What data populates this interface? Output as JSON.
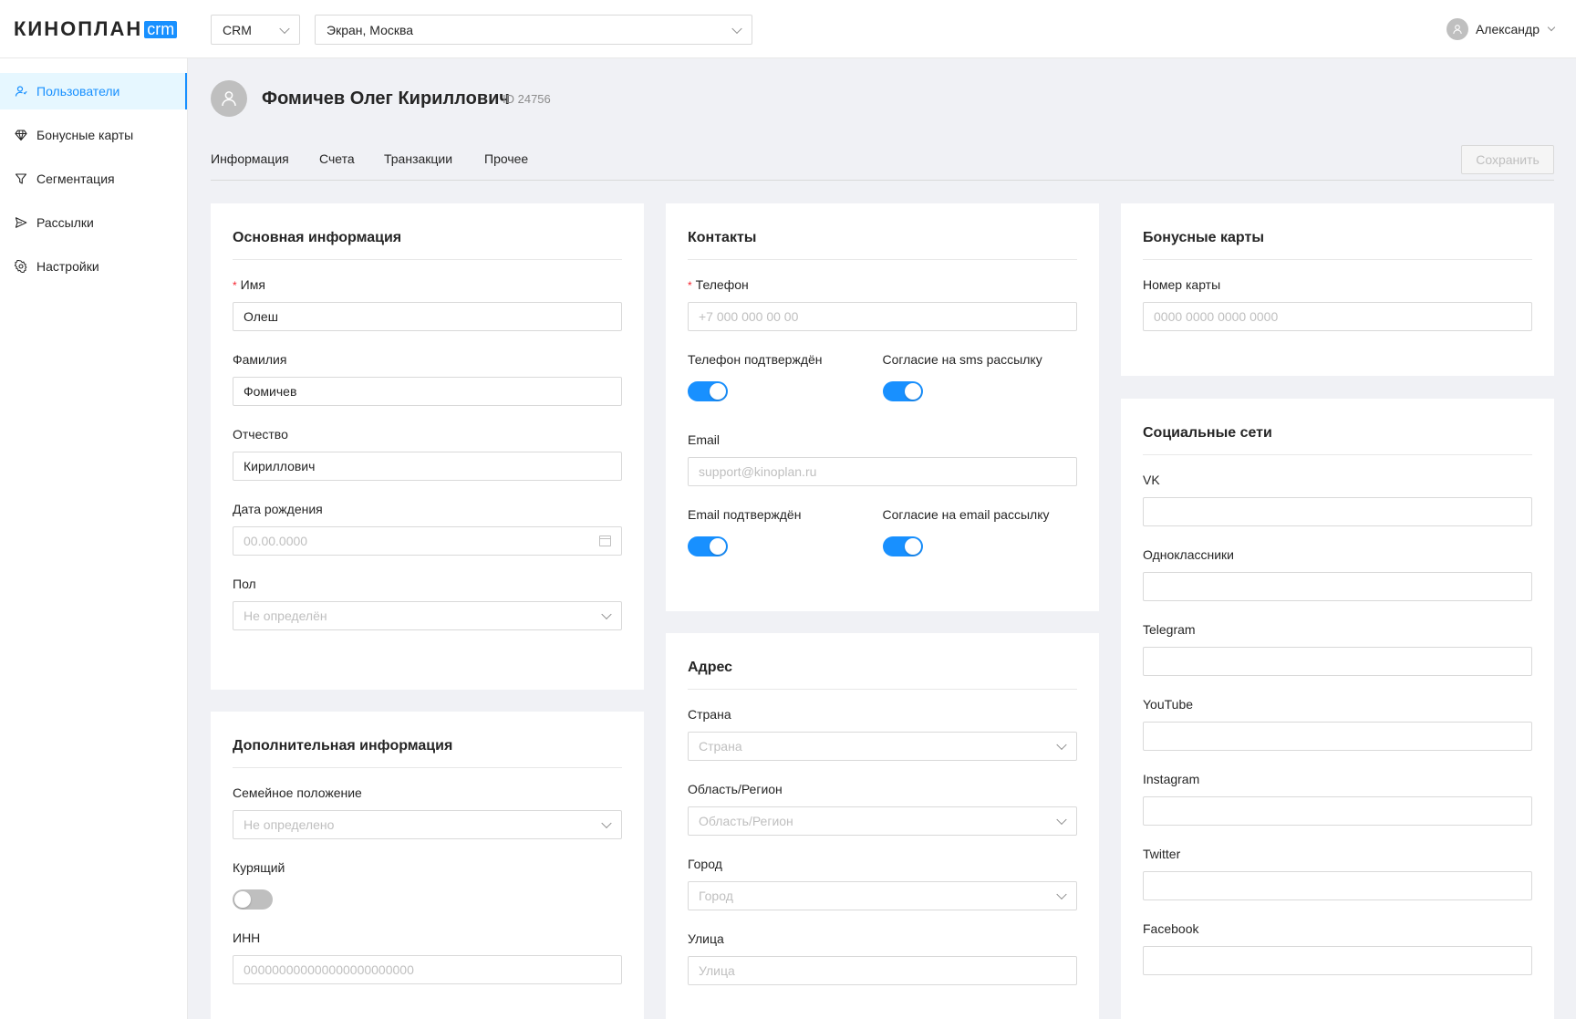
{
  "header": {
    "logo_text": "КИНОПЛАН",
    "logo_badge": "crm",
    "app_select": "CRM",
    "cinema_select": "Экран, Москва",
    "user_name": "Александр"
  },
  "sidebar": {
    "items": [
      {
        "label": "Пользователи",
        "icon": "users-icon",
        "active": true
      },
      {
        "label": "Бонусные карты",
        "icon": "diamond-icon",
        "active": false
      },
      {
        "label": "Сегментация",
        "icon": "funnel-icon",
        "active": false
      },
      {
        "label": "Рассылки",
        "icon": "send-icon",
        "active": false
      },
      {
        "label": "Настройки",
        "icon": "gear-icon",
        "active": false
      }
    ]
  },
  "page": {
    "title": "Фомичев Олег Кириллович",
    "id_label": "ID 24756",
    "tabs": [
      "Информация",
      "Счета",
      "Транзакции",
      "Прочее"
    ],
    "save_label": "Сохранить"
  },
  "basic_info": {
    "title": "Основная информация",
    "first_name_label": "Имя",
    "first_name_value": "Олеш",
    "last_name_label": "Фамилия",
    "last_name_value": "Фомичев",
    "patronymic_label": "Отчество",
    "patronymic_value": "Кириллович",
    "birth_label": "Дата рождения",
    "birth_placeholder": "00.00.0000",
    "gender_label": "Пол",
    "gender_placeholder": "Не определён"
  },
  "extra_info": {
    "title": "Дополнительная информация",
    "marital_label": "Семейное положение",
    "marital_placeholder": "Не определено",
    "smoker_label": "Курящий",
    "smoker_on": false,
    "inn_label": "ИНН",
    "inn_placeholder": "000000000000000000000000"
  },
  "contacts": {
    "title": "Контакты",
    "phone_label": "Телефон",
    "phone_placeholder": "+7 000 000 00 00",
    "phone_confirmed_label": "Телефон подтверждён",
    "phone_confirmed_on": true,
    "sms_consent_label": "Согласие на sms рассылку",
    "sms_consent_on": true,
    "email_label": "Email",
    "email_placeholder": "support@kinoplan.ru",
    "email_confirmed_label": "Email подтверждён",
    "email_confirmed_on": true,
    "email_consent_label": "Согласие на email рассылку",
    "email_consent_on": true
  },
  "address": {
    "title": "Адрес",
    "country_label": "Страна",
    "country_placeholder": "Страна",
    "region_label": "Область/Регион",
    "region_placeholder": "Область/Регион",
    "city_label": "Город",
    "city_placeholder": "Город",
    "street_label": "Улица",
    "street_placeholder": "Улица"
  },
  "bonus_cards": {
    "title": "Бонусные карты",
    "card_label": "Номер карты",
    "card_placeholder": "0000 0000 0000 0000"
  },
  "social": {
    "title": "Социальные сети",
    "networks": [
      "VK",
      "Одноклассники",
      "Telegram",
      "YouTube",
      "Instagram",
      "Twitter",
      "Facebook"
    ]
  },
  "colors": {
    "accent": "#1890ff",
    "page_bg": "#f0f1f5",
    "required": "#f5222d"
  }
}
